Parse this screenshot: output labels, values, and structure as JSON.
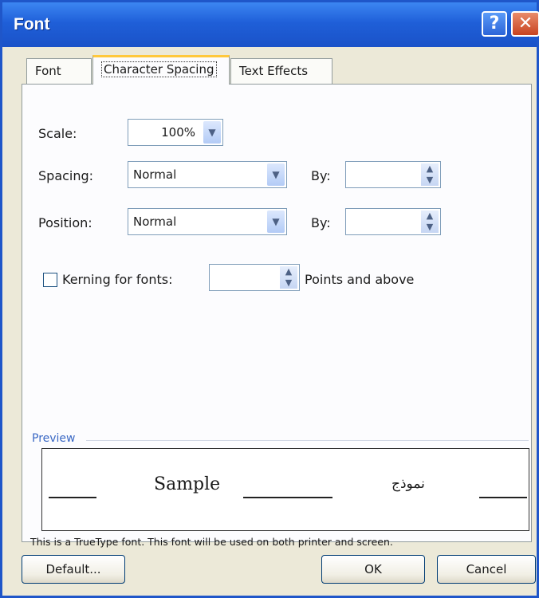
{
  "window": {
    "title": "Font",
    "help_glyph": "?",
    "close_glyph": "✕"
  },
  "tabs": [
    {
      "label": "Font",
      "active": false
    },
    {
      "label": "Character Spacing",
      "active": true
    },
    {
      "label": "Text Effects",
      "active": false
    }
  ],
  "scale": {
    "label": "Scale:",
    "value": "100%"
  },
  "spacing": {
    "label": "Spacing:",
    "value": "Normal",
    "by_label": "By:",
    "by_value": ""
  },
  "position": {
    "label": "Position:",
    "value": "Normal",
    "by_label": "By:",
    "by_value": ""
  },
  "kerning": {
    "label": "Kerning for fonts:",
    "checked": false,
    "value": "",
    "suffix": "Points and above"
  },
  "preview": {
    "label": "Preview",
    "sample_text": "Sample",
    "arabic_sample": "نموذج",
    "note": "This is a TrueType font. This font will be used on both printer and screen."
  },
  "buttons": {
    "default": "Default...",
    "ok": "OK",
    "cancel": "Cancel"
  },
  "colors": {
    "titlebar": "#1f5fd8",
    "active_tab_accent": "#ffc83c",
    "preview_label": "#3a68c4"
  }
}
